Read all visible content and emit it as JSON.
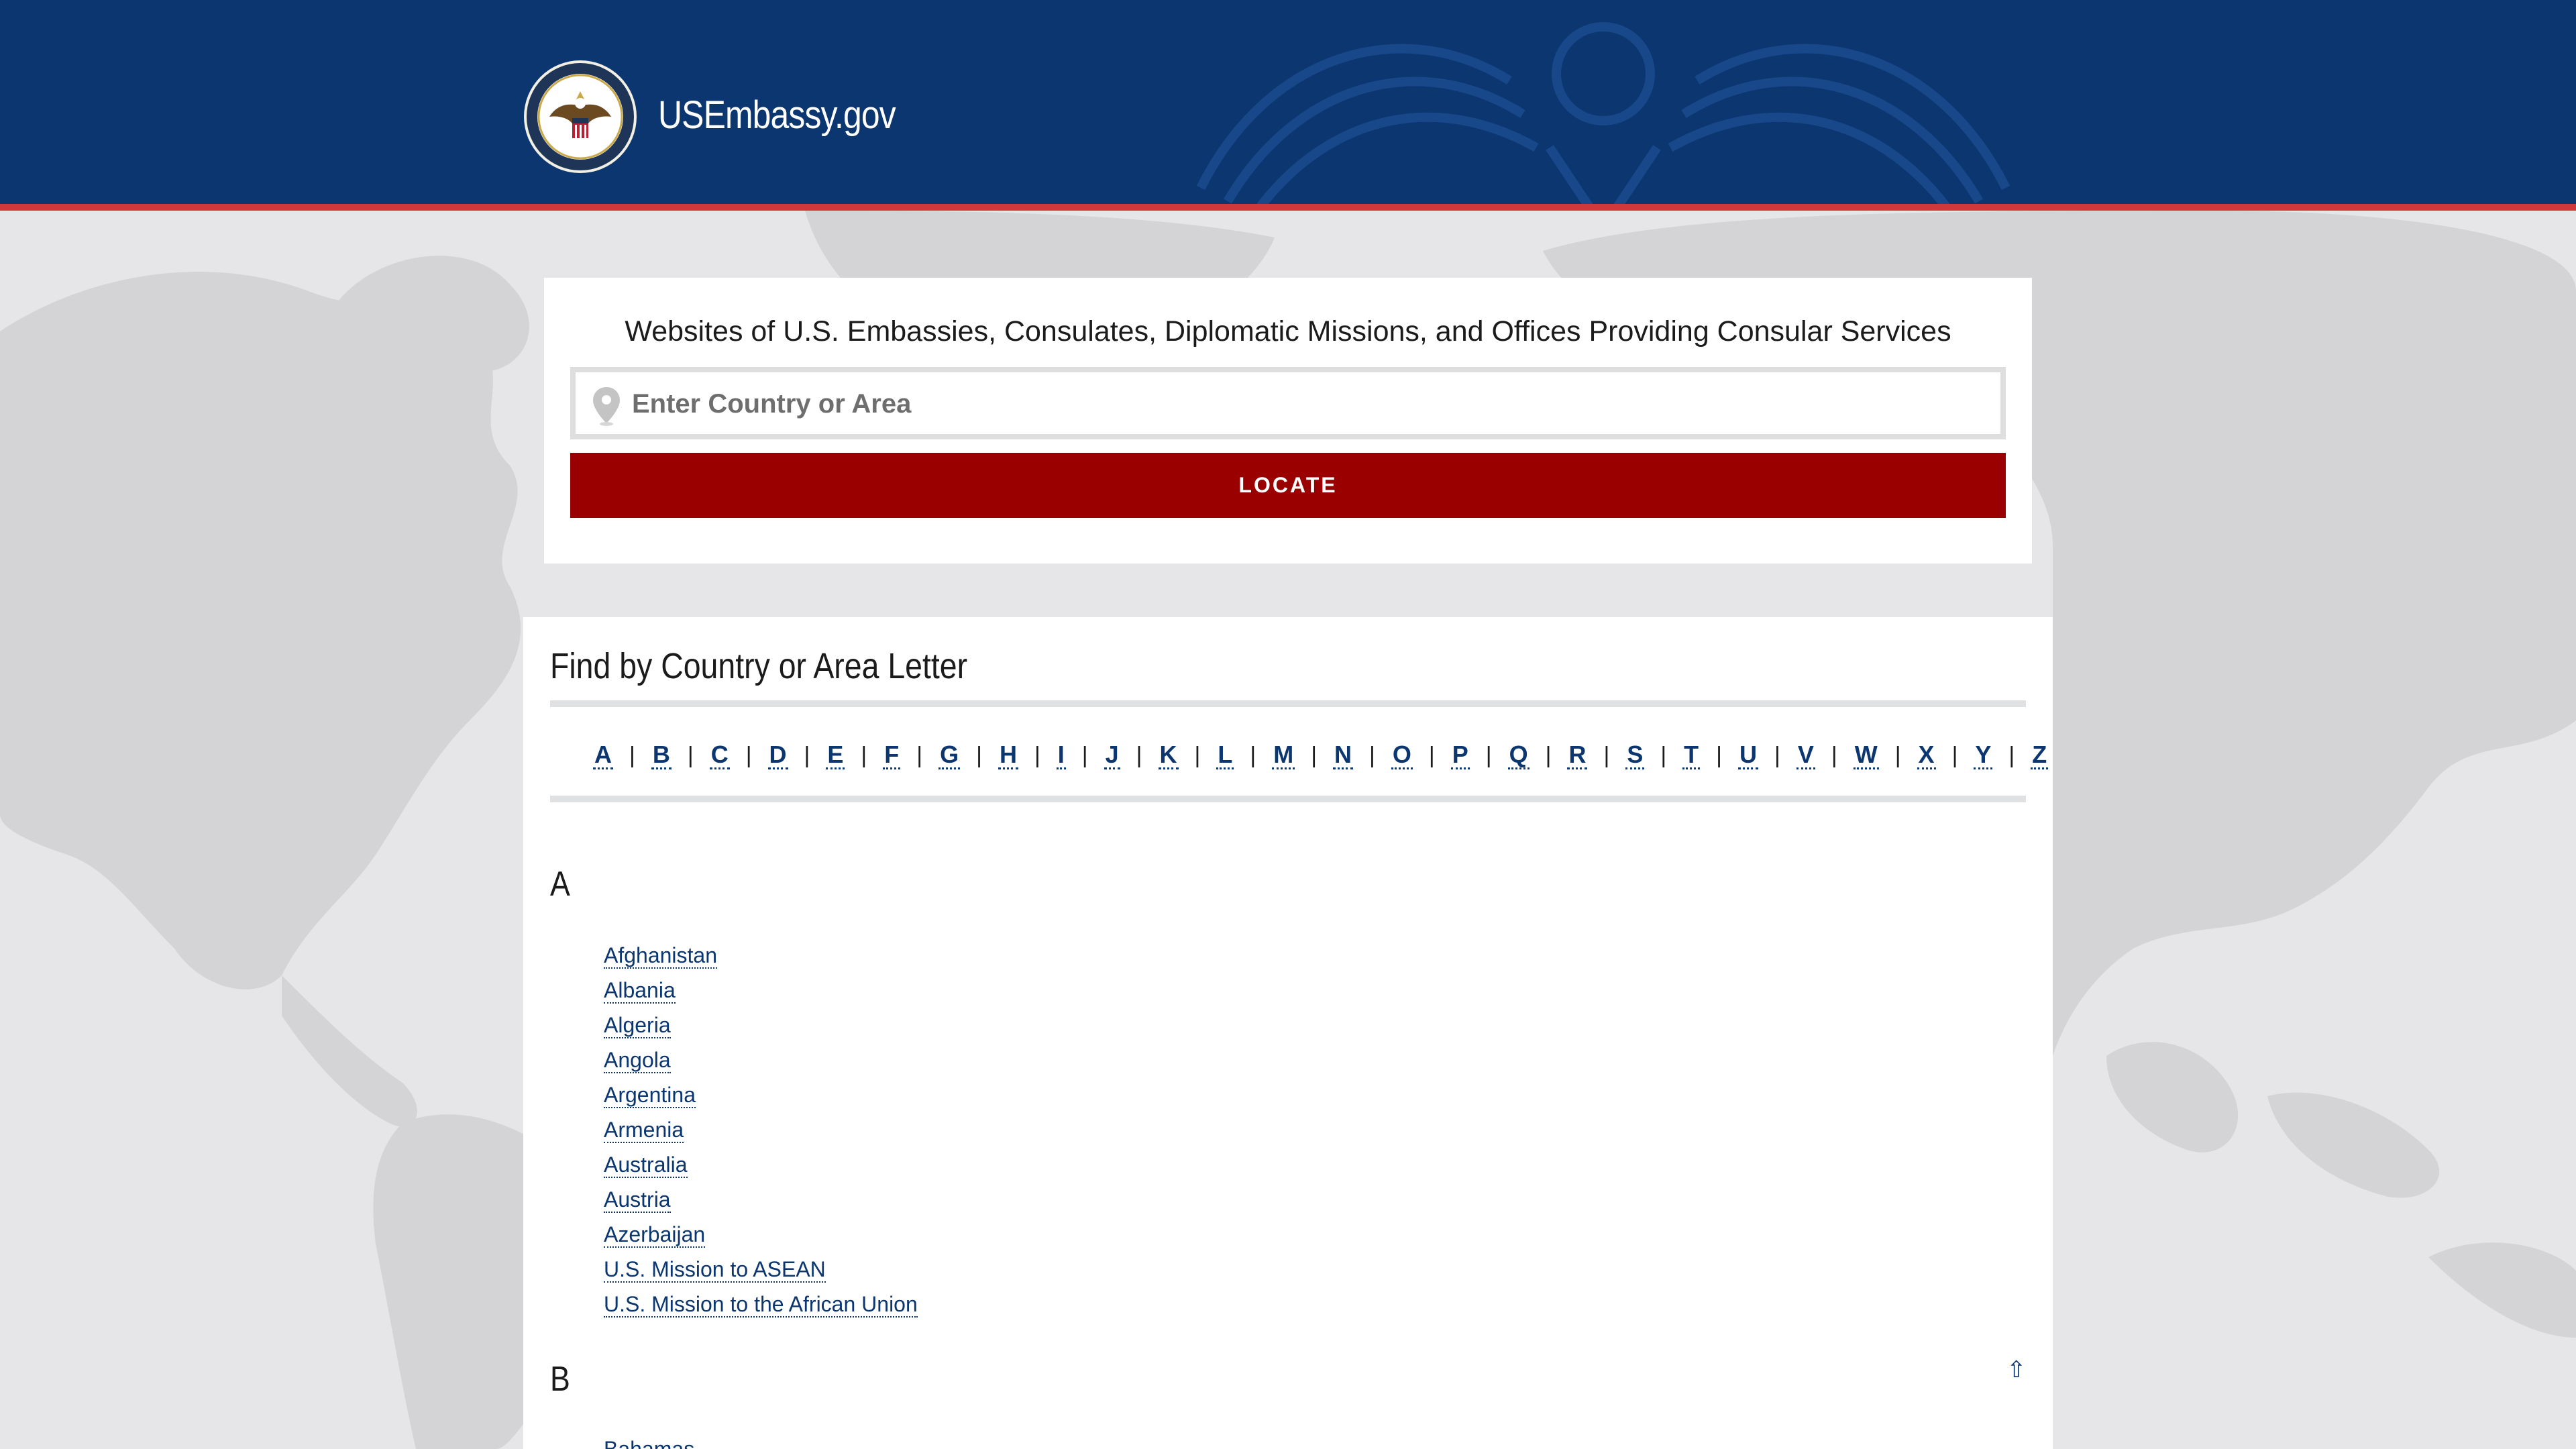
{
  "header": {
    "site_title": "USEmbassy.gov",
    "seal_icon": "department-of-state-seal",
    "colors": {
      "header_bg": "#0b3670",
      "header_stripe": "#d1383c"
    }
  },
  "search": {
    "title": "Websites of U.S. Embassies, Consulates, Diplomatic Missions, and Offices Providing Consular Services",
    "placeholder": "Enter Country or Area",
    "value": "",
    "icon": "map-pin-icon",
    "button_label": "LOCATE",
    "colors": {
      "button_bg": "#9b0000"
    }
  },
  "directory": {
    "title": "Find by Country or Area Letter",
    "letters": [
      "A",
      "B",
      "C",
      "D",
      "E",
      "F",
      "G",
      "H",
      "I",
      "J",
      "K",
      "L",
      "M",
      "N",
      "O",
      "P",
      "Q",
      "R",
      "S",
      "T",
      "U",
      "V",
      "W",
      "X",
      "Y",
      "Z"
    ],
    "separator": "|",
    "sections": [
      {
        "letter": "A",
        "countries": [
          "Afghanistan",
          "Albania",
          "Algeria",
          "Angola",
          "Argentina",
          "Armenia",
          "Australia",
          "Austria",
          "Azerbaijan",
          "U.S. Mission to ASEAN",
          "U.S. Mission to the African Union"
        ]
      },
      {
        "letter": "B",
        "countries": [
          "Bahamas"
        ]
      }
    ],
    "back_to_top": "⇧",
    "colors": {
      "link": "#0b3670"
    }
  }
}
